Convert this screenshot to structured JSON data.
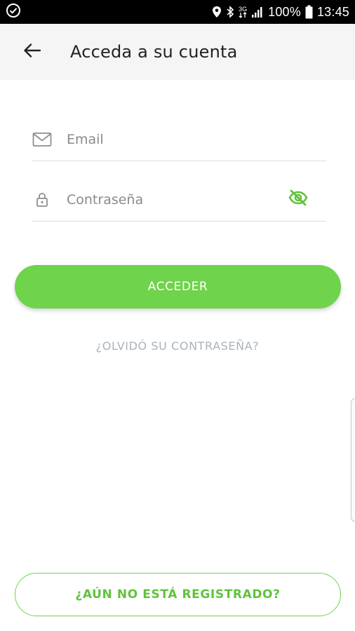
{
  "status_bar": {
    "battery": "100%",
    "time": "13:45",
    "network": "3G"
  },
  "app_bar": {
    "title": "Acceda a su cuenta"
  },
  "form": {
    "email_placeholder": "Email",
    "password_placeholder": "Contraseña"
  },
  "buttons": {
    "login": "ACCEDER",
    "forgot_password": "¿OLVIDÓ SU CONTRASEÑA?",
    "register": "¿AÚN NO ESTÁ REGISTRADO?"
  },
  "colors": {
    "accent": "#6fd34c",
    "link": "#a8b3bd",
    "status_bar": "#000000",
    "app_bar": "#f5f5f5"
  }
}
